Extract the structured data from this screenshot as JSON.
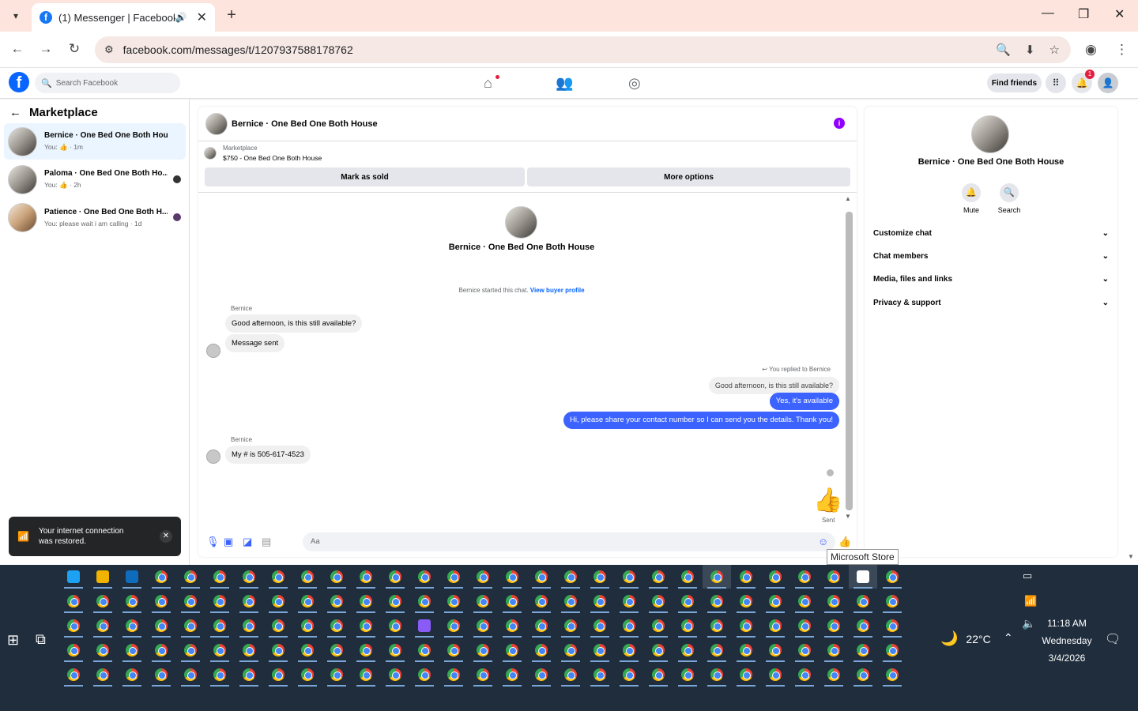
{
  "browser": {
    "tab_title": "(1) Messenger | Facebook",
    "url": "facebook.com/messages/t/1207937588178762"
  },
  "facebook": {
    "search_placeholder": "Search Facebook",
    "find_friends": "Find friends",
    "notification_count": "1"
  },
  "left_pane": {
    "title": "Marketplace",
    "conversations": [
      {
        "title": "Bernice · One Bed One Both House",
        "subtitle": "You: 👍 · 1m"
      },
      {
        "title": "Paloma · One Bed One Both Ho...",
        "subtitle": "You: 👍 · 2h"
      },
      {
        "title": "Patience · One Bed One Both H...",
        "subtitle": "You: please wait i am calling · 1d"
      }
    ]
  },
  "toast": {
    "text": "Your internet connection was restored."
  },
  "chat": {
    "header_name": "Bernice · One Bed One Both House",
    "marketplace_label": "Marketplace",
    "listing": "$750 - One Bed One Both House",
    "mark_sold": "Mark as sold",
    "more_options": "More options",
    "profile_name": "Bernice · One Bed One Both House",
    "started_text": "Bernice started this chat.",
    "view_buyer_profile": "View buyer profile",
    "sender1": "Bernice",
    "msg1": "Good afternoon, is this still available?",
    "msg2": "Message sent",
    "replied_label": "You replied to Bernice",
    "quoted": "Good afternoon, is this still available?",
    "out1": "Yes, it's available",
    "out2": "Hi, please share your contact number so I can send you the details. Thank you!",
    "sender2": "Bernice",
    "msg3": "My # is 505-617-4523",
    "sent_label": "Sent",
    "input_placeholder": "Aa"
  },
  "right_pane": {
    "name": "Bernice · One Bed One Both House",
    "mute": "Mute",
    "search": "Search",
    "sections": [
      "Customize chat",
      "Chat members",
      "Media, files and links",
      "Privacy & support"
    ]
  },
  "tooltip": "Microsoft Store",
  "system": {
    "temperature": "22°C",
    "time": "11:18 AM",
    "day": "Wednesday",
    "date": "3/4/2026"
  },
  "colors": {
    "accent": "#3c63ff",
    "fb_blue": "#0866ff",
    "taskbar": "#1f2d3d"
  }
}
